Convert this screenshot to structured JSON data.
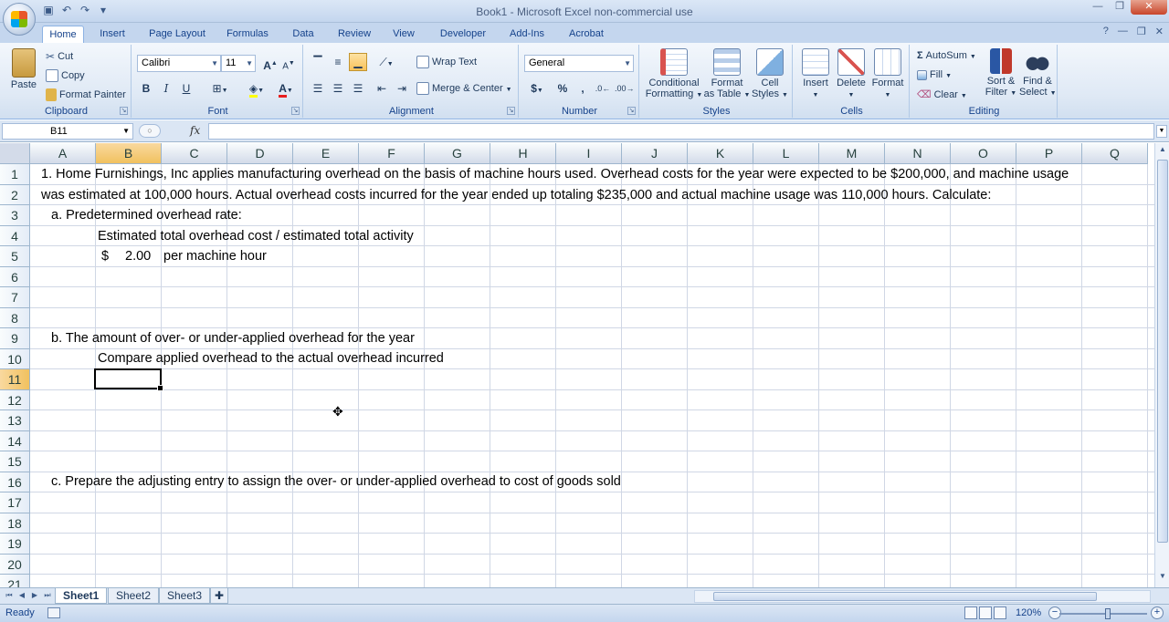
{
  "window": {
    "title": "Book1 - Microsoft Excel non-commercial use"
  },
  "ribbon_tabs": [
    "Home",
    "Insert",
    "Page Layout",
    "Formulas",
    "Data",
    "Review",
    "View",
    "Developer",
    "Add-Ins",
    "Acrobat"
  ],
  "clipboard": {
    "paste": "Paste",
    "cut": "Cut",
    "copy": "Copy",
    "format_painter": "Format Painter",
    "label": "Clipboard"
  },
  "font": {
    "name": "Calibri",
    "size": "11",
    "label": "Font",
    "bold": "B",
    "italic": "I",
    "underline": "U"
  },
  "alignment": {
    "wrap_text": "Wrap Text",
    "merge_center": "Merge & Center",
    "label": "Alignment"
  },
  "number": {
    "format": "General",
    "dollar": "$",
    "percent": "%",
    "comma": ",",
    "label": "Number"
  },
  "styles": {
    "conditional": [
      "Conditional",
      "Formatting"
    ],
    "format_table": [
      "Format",
      "as Table"
    ],
    "cell_styles": [
      "Cell",
      "Styles"
    ],
    "label": "Styles"
  },
  "cells": {
    "insert": "Insert",
    "delete": "Delete",
    "format": "Format",
    "label": "Cells"
  },
  "editing": {
    "autosum": "AutoSum",
    "fill": "Fill",
    "clear": "Clear",
    "sort_filter": [
      "Sort &",
      "Filter"
    ],
    "find_select": [
      "Find &",
      "Select"
    ],
    "label": "Editing"
  },
  "formula_bar": {
    "name_box": "B11",
    "fx": "fx",
    "formula": ""
  },
  "columns": [
    "A",
    "B",
    "C",
    "D",
    "E",
    "F",
    "G",
    "H",
    "I",
    "J",
    "K",
    "L",
    "M",
    "N",
    "O",
    "P",
    "Q"
  ],
  "selected_column": "B",
  "rows": [
    "1",
    "2",
    "3",
    "4",
    "5",
    "6",
    "7",
    "8",
    "9",
    "10",
    "11",
    "12",
    "13",
    "14",
    "15",
    "16",
    "17",
    "18",
    "19",
    "20",
    "21"
  ],
  "selected_row": "11",
  "cell_contents": {
    "r1": "1. Home Furnishings, Inc applies manufacturing overhead on the basis of machine hours used. Overhead costs for the year were expected to be $200,000, and machine usage",
    "r2": "was estimated at 100,000 hours. Actual overhead costs incurred for the year ended up totaling $235,000 and actual machine usage was 110,000 hours. Calculate:",
    "r3": "a. Predetermined overhead rate:",
    "r4": "Estimated total overhead cost / estimated total activity",
    "r5_currency": "$",
    "r5_value": "2.00",
    "r5_unit": "per machine hour",
    "r9": "b. The amount of over- or under-applied overhead for the year",
    "r10": "Compare applied overhead to the actual overhead incurred",
    "r16": "c. Prepare the adjusting entry to assign the over- or under-applied overhead to cost of goods sold"
  },
  "sheets": [
    "Sheet1",
    "Sheet2",
    "Sheet3"
  ],
  "active_sheet": "Sheet1",
  "status": {
    "mode": "Ready",
    "zoom": "120%"
  }
}
